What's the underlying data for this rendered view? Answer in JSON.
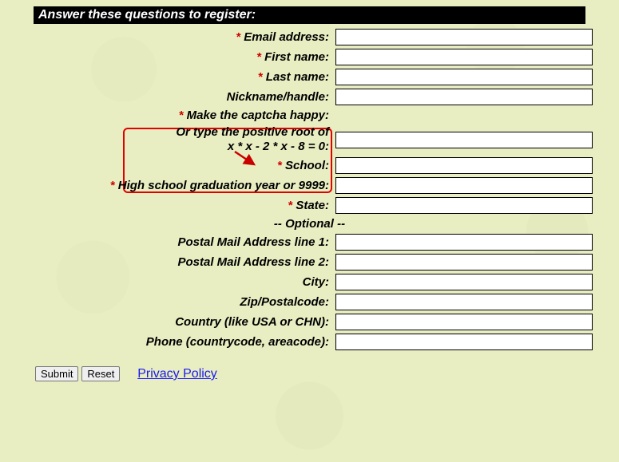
{
  "banner": "Answer these questions to register:",
  "required_mark": "*",
  "labels": {
    "email": "Email address:",
    "first": "First name:",
    "last": "Last name:",
    "nick": "Nickname/handle:",
    "captcha_line1": "Make the captcha happy:",
    "captcha_line2": "Or type the positive root of",
    "captcha_line3": "x * x - 2 * x - 8 = 0:",
    "school": "School:",
    "grad": "High school graduation year or 9999:",
    "state": "State:",
    "optional": "-- Optional --",
    "addr1": "Postal Mail Address line 1:",
    "addr2": "Postal Mail Address line 2:",
    "city": "City:",
    "zip": "Zip/Postalcode:",
    "country": "Country (like USA or CHN):",
    "phone": "Phone (countrycode, areacode):"
  },
  "buttons": {
    "submit": "Submit",
    "reset": "Reset"
  },
  "links": {
    "privacy": "Privacy Policy"
  }
}
